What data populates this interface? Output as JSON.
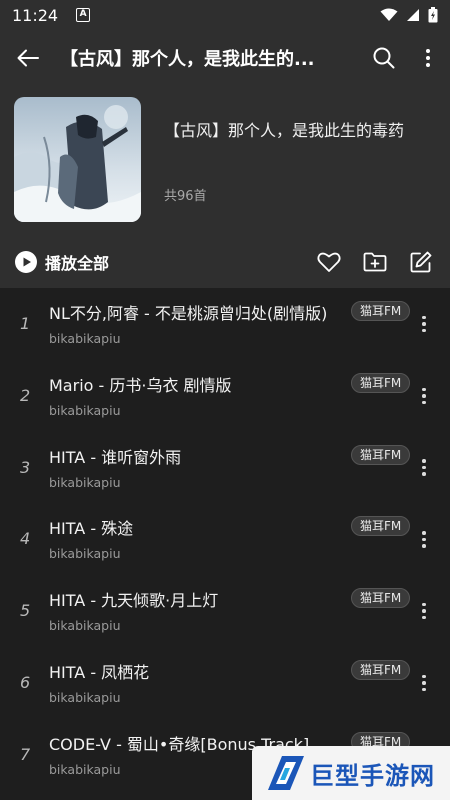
{
  "status_bar": {
    "time": "11:24",
    "notification_icon_letter": "A",
    "icons": [
      "wifi-icon",
      "signal-icon",
      "battery-icon"
    ]
  },
  "app_bar": {
    "title": "【古风】那个人，是我此生的...",
    "icons": [
      "back-arrow-icon",
      "search-icon",
      "more-vertical-icon"
    ]
  },
  "playlist": {
    "name": "【古风】那个人，是我此生的毒药",
    "count": "共96首"
  },
  "controls": {
    "play_all_label": "播放全部",
    "icons": [
      "play-circle-icon",
      "heart-icon",
      "folder-add-icon",
      "edit-icon"
    ]
  },
  "songs": [
    {
      "index": "1",
      "title": "NL不分,阿睿 - 不是桃源曾归处(剧情版)",
      "artist": "bikabikapiu",
      "badge": "猫耳FM"
    },
    {
      "index": "2",
      "title": "Mario - 历书·乌衣 剧情版",
      "artist": "bikabikapiu",
      "badge": "猫耳FM"
    },
    {
      "index": "3",
      "title": "HITA - 谁听窗外雨",
      "artist": "bikabikapiu",
      "badge": "猫耳FM"
    },
    {
      "index": "4",
      "title": "HITA - 殊途",
      "artist": "bikabikapiu",
      "badge": "猫耳FM"
    },
    {
      "index": "5",
      "title": "HITA - 九天倾歌·月上灯",
      "artist": "bikabikapiu",
      "badge": "猫耳FM"
    },
    {
      "index": "6",
      "title": "HITA - 凤栖花",
      "artist": "bikabikapiu",
      "badge": "猫耳FM"
    },
    {
      "index": "7",
      "title": "CODE-V - 蜀山•奇缘[Bonus Track]",
      "artist": "bikabikapiu",
      "badge": "猫耳FM"
    }
  ],
  "watermark": {
    "text": "巨型手游网"
  },
  "colors": {
    "header_bg": "#2f2f2f",
    "list_bg": "#1e1e1e",
    "watermark_blue": "#1b56b8"
  }
}
